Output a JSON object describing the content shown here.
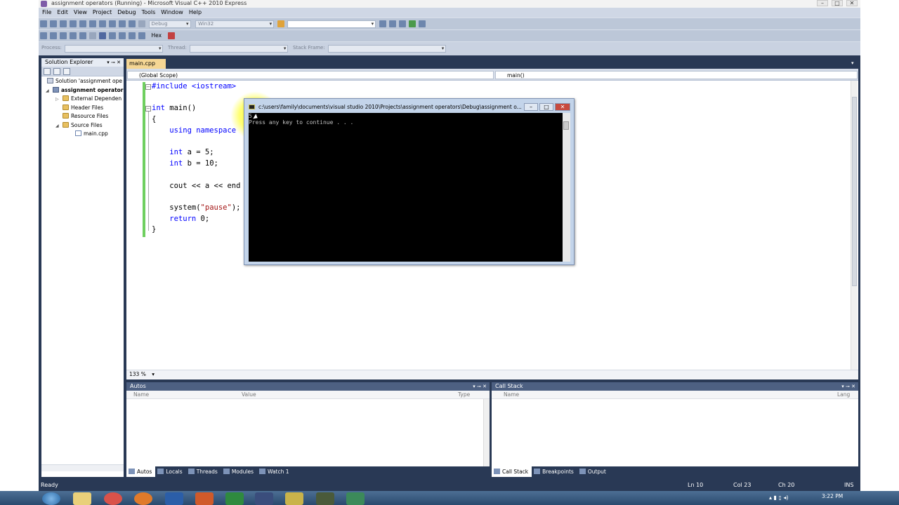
{
  "window": {
    "title": "assignment operators (Running) - Microsoft Visual C++ 2010 Express"
  },
  "menu": [
    "File",
    "Edit",
    "View",
    "Project",
    "Debug",
    "Tools",
    "Window",
    "Help"
  ],
  "toolbar": {
    "config": "Debug",
    "platform": "Win32",
    "hex_label": "Hex",
    "process_label": "Process:",
    "thread_label": "Thread:",
    "stack_frame_label": "Stack Frame:"
  },
  "solution_explorer": {
    "title": "Solution Explorer",
    "items": [
      {
        "label": "Solution 'assignment ope",
        "icon": "solution-icon"
      },
      {
        "label": "assignment operator",
        "icon": "project-icon"
      },
      {
        "label": "External Dependen",
        "icon": "folder-icon"
      },
      {
        "label": "Header Files",
        "icon": "folder-icon"
      },
      {
        "label": "Resource Files",
        "icon": "folder-icon"
      },
      {
        "label": "Source Files",
        "icon": "folder-icon"
      },
      {
        "label": "main.cpp",
        "icon": "cpp-file-icon"
      }
    ]
  },
  "editor": {
    "tab": "main.cpp",
    "scope": "(Global Scope)",
    "function": "main()",
    "zoom": "133 %",
    "lines": {
      "l1": "#include <iostream>",
      "l3a": "int",
      "l3b": " main()",
      "l4": "{",
      "l5a": "    using namespace",
      "l7a": "    int",
      "l7b": " a = 5;",
      "l8a": "    int",
      "l8b": " b = 10;",
      "l10": "    cout << a << end",
      "l12a": "    system(",
      "l12b": "\"pause\"",
      "l12c": ");",
      "l13a": "    return",
      "l13b": " 0;",
      "l14": "}"
    }
  },
  "console": {
    "title": "c:\\users\\family\\documents\\visual studio 2010\\Projects\\assignment operators\\Debug\\assignment o...",
    "output_line1": "5",
    "output_line2": "Press any key to continue . . ."
  },
  "autos": {
    "title": "Autos",
    "columns": [
      "Name",
      "Value",
      "Type"
    ]
  },
  "callstack": {
    "title": "Call Stack",
    "columns": [
      "Name",
      "Lang"
    ]
  },
  "bottom_tabs_left": [
    "Autos",
    "Locals",
    "Threads",
    "Modules",
    "Watch 1"
  ],
  "bottom_tabs_right": [
    "Call Stack",
    "Breakpoints",
    "Output"
  ],
  "status": {
    "ready": "Ready",
    "ln": "Ln 10",
    "col": "Col 23",
    "ch": "Ch 20",
    "mode": "INS"
  },
  "clock": {
    "time": "3:22 PM"
  }
}
